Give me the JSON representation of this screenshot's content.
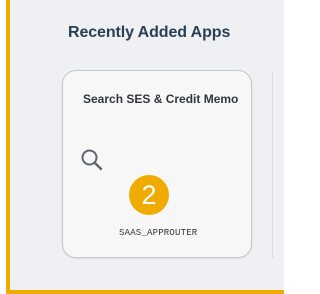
{
  "section": {
    "title": "Recently Added Apps"
  },
  "tile": {
    "title": "Search SES & Credit Memo",
    "icon": "search-icon",
    "footer": "SAAS_APPROUTER"
  },
  "badge": {
    "number": "2"
  },
  "colors": {
    "highlight": "#f0ab00",
    "title_text": "#2c3e50"
  }
}
